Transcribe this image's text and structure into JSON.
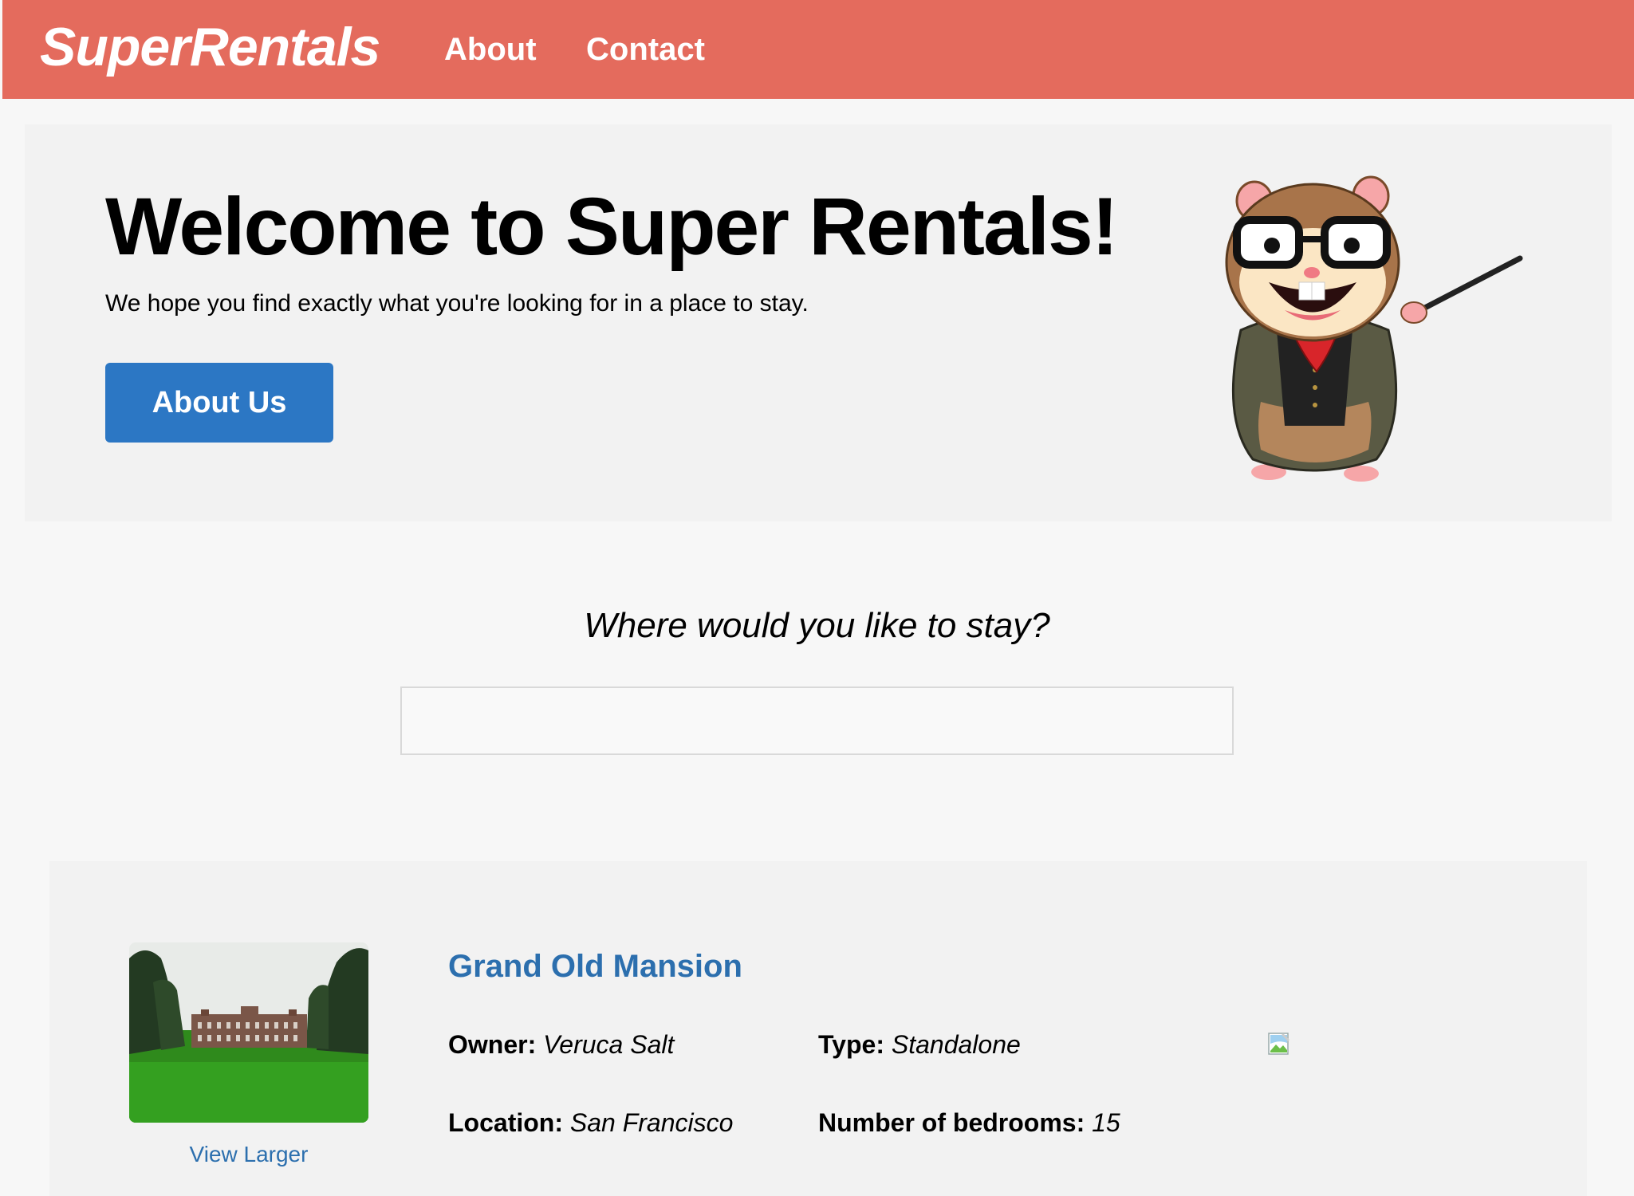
{
  "nav": {
    "brand": "SuperRentals",
    "links": [
      {
        "label": "About"
      },
      {
        "label": "Contact"
      }
    ]
  },
  "jumbo": {
    "title": "Welcome to Super Rentals!",
    "subtitle": "We hope you find exactly what you're looking for in a place to stay.",
    "button_label": "About Us"
  },
  "search": {
    "prompt": "Where would you like to stay?",
    "value": "",
    "placeholder": ""
  },
  "listings": [
    {
      "title": "Grand Old Mansion",
      "image_link": "View Larger",
      "owner_label": "Owner:",
      "owner": "Veruca Salt",
      "type_label": "Type:",
      "type": "Standalone",
      "location_label": "Location:",
      "location": "San Francisco",
      "bedrooms_label": "Number of bedrooms:",
      "bedrooms": "15"
    }
  ],
  "colors": {
    "navbar": "#e46b5d",
    "primary_button": "#2c77c4",
    "link": "#2c6fae"
  },
  "icons": {
    "mascot": "tomster-hamster-mascot-illustration",
    "broken_image": "broken-image-icon"
  }
}
